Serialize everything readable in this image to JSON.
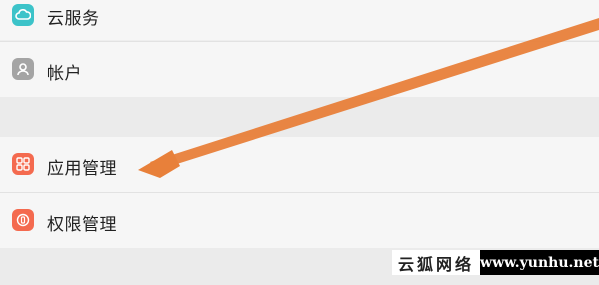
{
  "settings_list": {
    "items": [
      {
        "label": "云服务",
        "icon": "cloud-icon",
        "color": "#3cc3c9"
      },
      {
        "label": "帐户",
        "icon": "account-icon",
        "color": "#9e9e9e"
      },
      {
        "label": "应用管理",
        "icon": "app-management-icon",
        "color": "#f46a4f"
      },
      {
        "label": "权限管理",
        "icon": "permission-management-icon",
        "color": "#f46a4f"
      }
    ]
  },
  "annotation": {
    "color": "#e8803a"
  },
  "watermark": {
    "left_text": "云狐网络",
    "right_text": "www.yunhu.net"
  }
}
